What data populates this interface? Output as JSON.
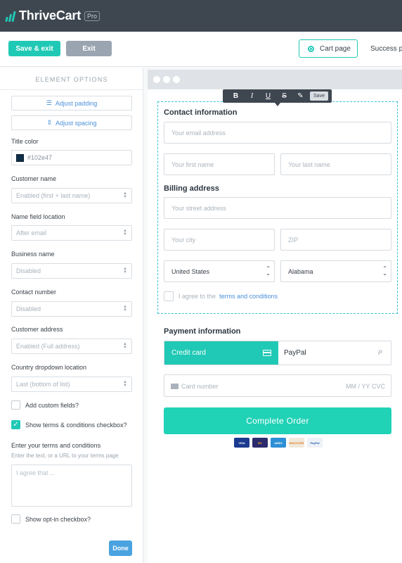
{
  "app": {
    "name": "ThriveCart",
    "badge": "Pro"
  },
  "actions": {
    "save_exit": "Save & exit",
    "exit": "Exit",
    "cart_page": "Cart page",
    "success_page": "Success pa"
  },
  "panel": {
    "title": "ELEMENT OPTIONS",
    "adjust_padding": "Adjust padding",
    "adjust_spacing": "Adjust spacing",
    "title_color_label": "Title color",
    "title_color_value": "#102e47",
    "title_color": "#102e47",
    "customer_name_label": "Customer name",
    "customer_name_value": "Enabled (first + last name)",
    "name_location_label": "Name field location",
    "name_location_value": "After email",
    "business_name_label": "Business name",
    "business_name_value": "Disabled",
    "contact_number_label": "Contact number",
    "contact_number_value": "Disabled",
    "customer_address_label": "Customer address",
    "customer_address_value": "Enabled (Full address)",
    "country_location_label": "Country dropdown location",
    "country_location_value": "Last (bottom of list)",
    "add_custom_fields": "Add custom fields?",
    "add_custom_fields_checked": false,
    "show_terms": "Show terms & conditions checkbox?",
    "show_terms_checked": true,
    "terms_label": "Enter your terms and conditions",
    "terms_help": "Enter the text, or a URL to your terms page",
    "terms_placeholder": "I agree that ...",
    "show_optin": "Show opt-in checkbox?",
    "show_optin_checked": false,
    "done": "Done"
  },
  "toolbar": {
    "bold": "B",
    "italic": "I",
    "underline": "U",
    "strike": "S",
    "save": "Save"
  },
  "form": {
    "contact_heading": "Contact information",
    "email_placeholder": "Your email address",
    "first_name_placeholder": "Your first name",
    "last_name_placeholder": "Your last name",
    "billing_heading": "Billing address",
    "street_placeholder": "Your street address",
    "city_placeholder": "Your city",
    "zip_placeholder": "ZIP",
    "country_value": "United States",
    "state_value": "Alabama",
    "agree_prefix": "I agree to the",
    "agree_link": "terms and conditions",
    "payment_heading": "Payment information",
    "tab_credit_card": "Credit card",
    "tab_paypal": "PayPal",
    "card_number_placeholder": "Card number",
    "card_expiry_placeholder": "MM / YY",
    "card_cvc_placeholder": "CVC",
    "complete_order": "Complete Order",
    "card_logos": [
      "VISA",
      "MC",
      "AMEX",
      "DISCOVER",
      "PayPal"
    ]
  },
  "colors": {
    "accent": "#20c9b5",
    "topbar": "#3e4650",
    "link": "#4a90d9"
  }
}
